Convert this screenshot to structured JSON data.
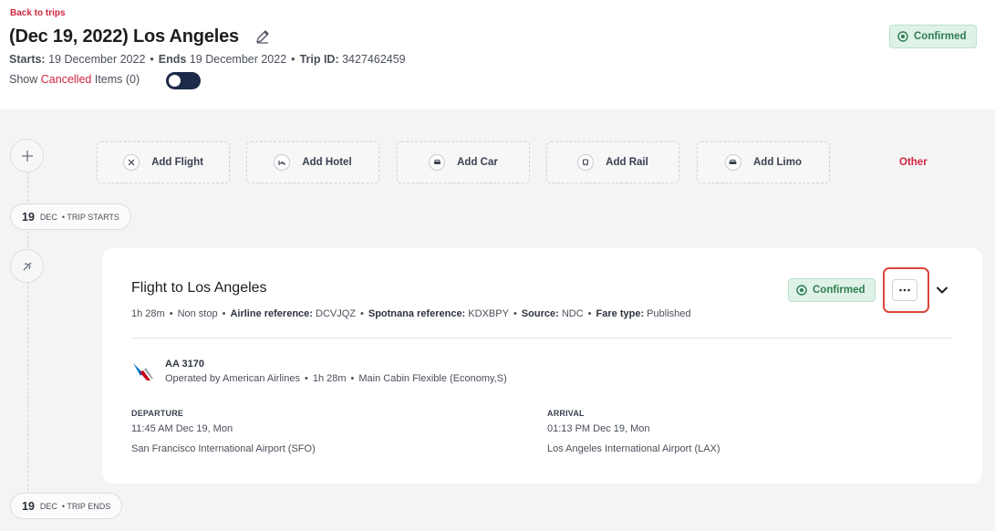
{
  "header": {
    "back_label": "Back to trips",
    "title": "(Dec 19, 2022) Los Angeles",
    "starts_label": "Starts:",
    "starts_value": "19 December 2022",
    "ends_label": "Ends",
    "ends_value": "19 December 2022",
    "trip_id_label": "Trip ID:",
    "trip_id_value": "3427462459",
    "show_prefix": "Show",
    "show_cancelled": "Cancelled",
    "show_suffix": "Items (0)",
    "toggle_on": false,
    "status_badge": "Confirmed"
  },
  "add_items": [
    {
      "label": "Add Flight",
      "icon": "plane-icon"
    },
    {
      "label": "Add Hotel",
      "icon": "bed-icon"
    },
    {
      "label": "Add Car",
      "icon": "car-icon"
    },
    {
      "label": "Add Rail",
      "icon": "train-icon"
    },
    {
      "label": "Add Limo",
      "icon": "limo-icon"
    }
  ],
  "other_label": "Other",
  "trip_start": {
    "day": "19",
    "month": "DEC",
    "label": "• TRIP STARTS"
  },
  "trip_end": {
    "day": "19",
    "month": "DEC",
    "label": "• TRIP ENDS"
  },
  "flight": {
    "title": "Flight to Los Angeles",
    "status": "Confirmed",
    "duration": "1h 28m",
    "stops": "Non stop",
    "airline_ref_label": "Airline reference:",
    "airline_ref": "DCVJQZ",
    "spotnana_ref_label": "Spotnana reference:",
    "spotnana_ref": "KDXBPY",
    "source_label": "Source:",
    "source": "NDC",
    "fare_label": "Fare type:",
    "fare": "Published",
    "segment": {
      "flight_number": "AA 3170",
      "operated_by": "Operated by American Airlines",
      "duration": "1h 28m",
      "cabin": "Main Cabin Flexible (Economy,S)"
    },
    "departure": {
      "label": "DEPARTURE",
      "time": "11:45 AM Dec 19, Mon",
      "airport": "San Francisco International Airport (SFO)"
    },
    "arrival": {
      "label": "ARRIVAL",
      "time": "01:13 PM Dec 19, Mon",
      "airport": "Los Angeles International Airport (LAX)"
    }
  },
  "colors": {
    "brand_red": "#d0253f",
    "confirmed_green": "#2e7d4f",
    "highlight": "#d9453a"
  }
}
